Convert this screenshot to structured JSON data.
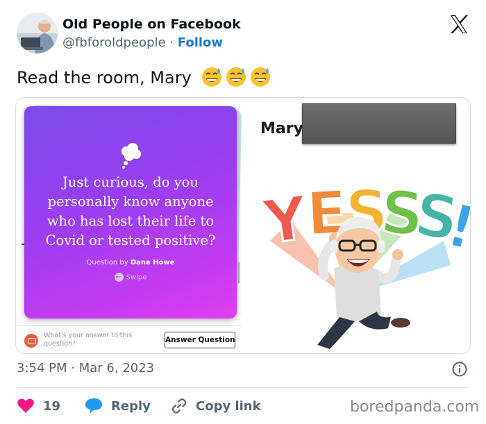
{
  "header": {
    "display_name": "Old People on Facebook",
    "handle": "@fbforoldpeople",
    "separator": "·",
    "follow_label": "Follow",
    "platform_icon": "x-logo-icon"
  },
  "tweet": {
    "text": "Read the room, Mary",
    "emoji": "😅😅😅"
  },
  "media": {
    "question_card": {
      "icon": "thought-bubble-icon",
      "question": "Just curious, do you personally know anyone who has lost their life to Covid or tested positive?",
      "asked_by_prefix": "Question by",
      "asked_by_name": "Dana Howe",
      "swipe_label": "Swipe",
      "answer_prompt": "What's your answer to this question?",
      "answer_button": "Answer Question"
    },
    "reply": {
      "name": "Mary",
      "sticker_text": "YESSS!",
      "sticker_colors": [
        "#ee5a4e",
        "#f3a43a",
        "#6fbf4b",
        "#4ab3a7",
        "#3aa3e8"
      ]
    }
  },
  "meta": {
    "time": "3:54 PM",
    "separator": "·",
    "date": "Mar 6, 2023"
  },
  "actions": {
    "likes_count": "19",
    "reply_label": "Reply",
    "copy_label": "Copy link"
  },
  "watermark": "boredpanda.com",
  "colors": {
    "accent": "#1d7bd1",
    "like": "#f91880",
    "reply_icon": "#1d9bf0",
    "text_secondary": "#536471"
  }
}
